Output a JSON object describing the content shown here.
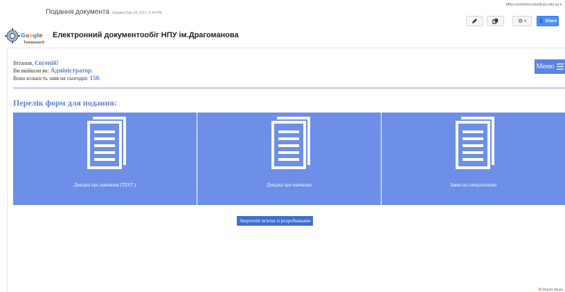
{
  "header": {
    "doc_title": "Подання документа",
    "updated": "Updated Sep 24, 2017, 6:44 PM",
    "user_email": "188yu.mosherkovska@npu.edu.ua ▾",
    "share_label": "Share",
    "app_title": "Електронний документообіг НПУ ім.Драгоманова",
    "logo_text": "Google Технології"
  },
  "welcome": {
    "greeting_prefix": "Вітання, ",
    "user_name": "Євгеній!",
    "role_prefix": "Ви ввійшли як: ",
    "role": "Адміністратор.",
    "count_prefix": "Вона кількість заяв на сьогодні: ",
    "count": "150."
  },
  "menu": {
    "label": "Меню"
  },
  "forms": {
    "title": "Перелік форм для подання:",
    "items": [
      {
        "label": "Довідка про навчання (TEST )",
        "icon": "document-stack-icon"
      },
      {
        "label": "Довідка про навчання",
        "icon": "document-stack-icon"
      },
      {
        "label": "Заява на спеціалізацію",
        "icon": "document-stack-icon"
      }
    ]
  },
  "feedback": {
    "label": "Зворотній зв'язок із розробниками"
  },
  "footer": {
    "report_label": "Report abuse"
  },
  "colors": {
    "card": "#6e8fe8",
    "accent": "#5b7fd6",
    "button": "#3f6cd1",
    "share": "#4d90fe"
  }
}
